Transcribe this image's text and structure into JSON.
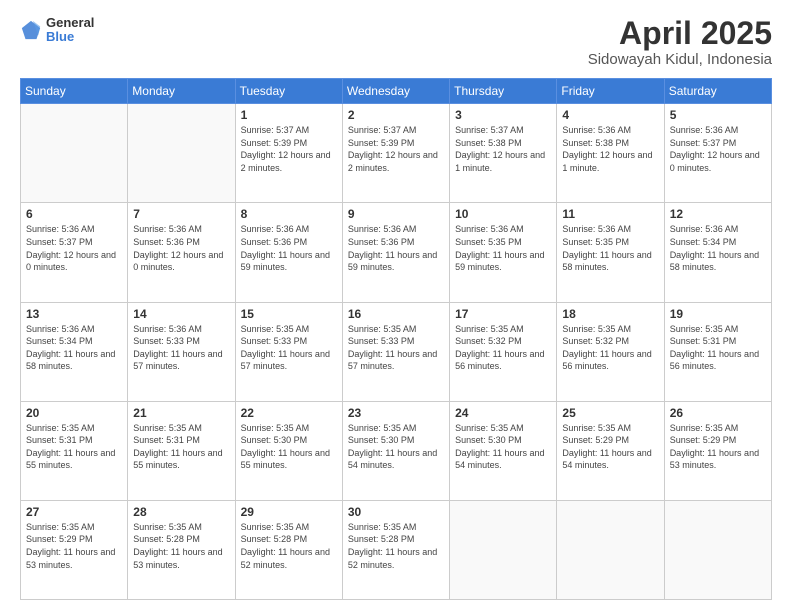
{
  "header": {
    "logo_line1": "General",
    "logo_line2": "Blue",
    "title": "April 2025",
    "subtitle": "Sidowayah Kidul, Indonesia"
  },
  "days_of_week": [
    "Sunday",
    "Monday",
    "Tuesday",
    "Wednesday",
    "Thursday",
    "Friday",
    "Saturday"
  ],
  "weeks": [
    [
      {
        "day": "",
        "info": ""
      },
      {
        "day": "",
        "info": ""
      },
      {
        "day": "1",
        "info": "Sunrise: 5:37 AM\nSunset: 5:39 PM\nDaylight: 12 hours\nand 2 minutes."
      },
      {
        "day": "2",
        "info": "Sunrise: 5:37 AM\nSunset: 5:39 PM\nDaylight: 12 hours\nand 2 minutes."
      },
      {
        "day": "3",
        "info": "Sunrise: 5:37 AM\nSunset: 5:38 PM\nDaylight: 12 hours\nand 1 minute."
      },
      {
        "day": "4",
        "info": "Sunrise: 5:36 AM\nSunset: 5:38 PM\nDaylight: 12 hours\nand 1 minute."
      },
      {
        "day": "5",
        "info": "Sunrise: 5:36 AM\nSunset: 5:37 PM\nDaylight: 12 hours\nand 0 minutes."
      }
    ],
    [
      {
        "day": "6",
        "info": "Sunrise: 5:36 AM\nSunset: 5:37 PM\nDaylight: 12 hours\nand 0 minutes."
      },
      {
        "day": "7",
        "info": "Sunrise: 5:36 AM\nSunset: 5:36 PM\nDaylight: 12 hours\nand 0 minutes."
      },
      {
        "day": "8",
        "info": "Sunrise: 5:36 AM\nSunset: 5:36 PM\nDaylight: 11 hours\nand 59 minutes."
      },
      {
        "day": "9",
        "info": "Sunrise: 5:36 AM\nSunset: 5:36 PM\nDaylight: 11 hours\nand 59 minutes."
      },
      {
        "day": "10",
        "info": "Sunrise: 5:36 AM\nSunset: 5:35 PM\nDaylight: 11 hours\nand 59 minutes."
      },
      {
        "day": "11",
        "info": "Sunrise: 5:36 AM\nSunset: 5:35 PM\nDaylight: 11 hours\nand 58 minutes."
      },
      {
        "day": "12",
        "info": "Sunrise: 5:36 AM\nSunset: 5:34 PM\nDaylight: 11 hours\nand 58 minutes."
      }
    ],
    [
      {
        "day": "13",
        "info": "Sunrise: 5:36 AM\nSunset: 5:34 PM\nDaylight: 11 hours\nand 58 minutes."
      },
      {
        "day": "14",
        "info": "Sunrise: 5:36 AM\nSunset: 5:33 PM\nDaylight: 11 hours\nand 57 minutes."
      },
      {
        "day": "15",
        "info": "Sunrise: 5:35 AM\nSunset: 5:33 PM\nDaylight: 11 hours\nand 57 minutes."
      },
      {
        "day": "16",
        "info": "Sunrise: 5:35 AM\nSunset: 5:33 PM\nDaylight: 11 hours\nand 57 minutes."
      },
      {
        "day": "17",
        "info": "Sunrise: 5:35 AM\nSunset: 5:32 PM\nDaylight: 11 hours\nand 56 minutes."
      },
      {
        "day": "18",
        "info": "Sunrise: 5:35 AM\nSunset: 5:32 PM\nDaylight: 11 hours\nand 56 minutes."
      },
      {
        "day": "19",
        "info": "Sunrise: 5:35 AM\nSunset: 5:31 PM\nDaylight: 11 hours\nand 56 minutes."
      }
    ],
    [
      {
        "day": "20",
        "info": "Sunrise: 5:35 AM\nSunset: 5:31 PM\nDaylight: 11 hours\nand 55 minutes."
      },
      {
        "day": "21",
        "info": "Sunrise: 5:35 AM\nSunset: 5:31 PM\nDaylight: 11 hours\nand 55 minutes."
      },
      {
        "day": "22",
        "info": "Sunrise: 5:35 AM\nSunset: 5:30 PM\nDaylight: 11 hours\nand 55 minutes."
      },
      {
        "day": "23",
        "info": "Sunrise: 5:35 AM\nSunset: 5:30 PM\nDaylight: 11 hours\nand 54 minutes."
      },
      {
        "day": "24",
        "info": "Sunrise: 5:35 AM\nSunset: 5:30 PM\nDaylight: 11 hours\nand 54 minutes."
      },
      {
        "day": "25",
        "info": "Sunrise: 5:35 AM\nSunset: 5:29 PM\nDaylight: 11 hours\nand 54 minutes."
      },
      {
        "day": "26",
        "info": "Sunrise: 5:35 AM\nSunset: 5:29 PM\nDaylight: 11 hours\nand 53 minutes."
      }
    ],
    [
      {
        "day": "27",
        "info": "Sunrise: 5:35 AM\nSunset: 5:29 PM\nDaylight: 11 hours\nand 53 minutes."
      },
      {
        "day": "28",
        "info": "Sunrise: 5:35 AM\nSunset: 5:28 PM\nDaylight: 11 hours\nand 53 minutes."
      },
      {
        "day": "29",
        "info": "Sunrise: 5:35 AM\nSunset: 5:28 PM\nDaylight: 11 hours\nand 52 minutes."
      },
      {
        "day": "30",
        "info": "Sunrise: 5:35 AM\nSunset: 5:28 PM\nDaylight: 11 hours\nand 52 minutes."
      },
      {
        "day": "",
        "info": ""
      },
      {
        "day": "",
        "info": ""
      },
      {
        "day": "",
        "info": ""
      }
    ]
  ]
}
